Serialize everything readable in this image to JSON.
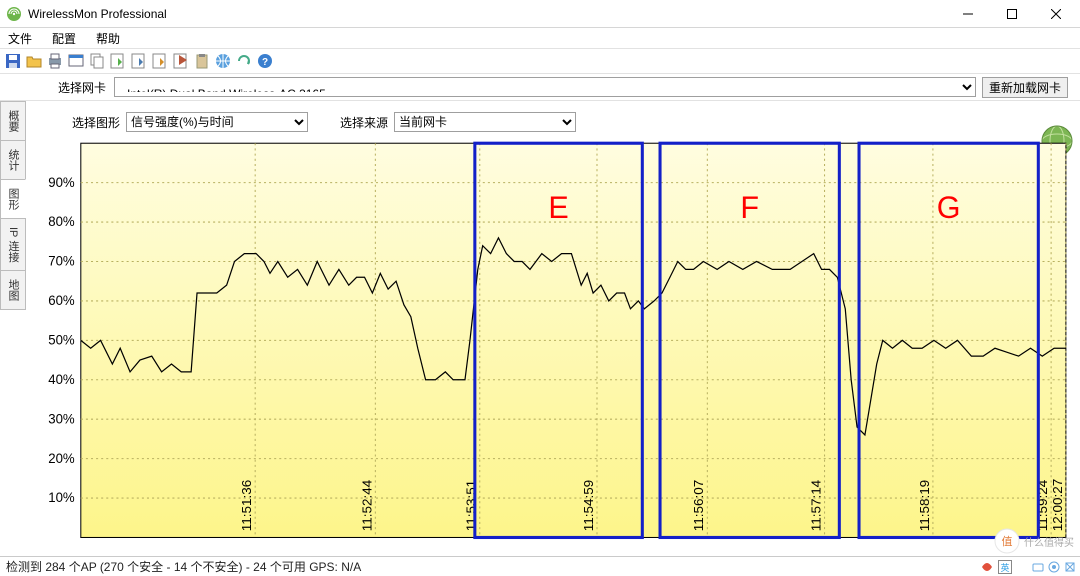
{
  "window": {
    "title": "WirelessMon Professional"
  },
  "menu": [
    "文件",
    "配置",
    "帮助"
  ],
  "adapter": {
    "label": "选择网卡",
    "value": "Intel(R) Dual Band Wireless-AC 3165",
    "reload": "重新加载网卡"
  },
  "tabs": [
    "概要",
    "统计",
    "图形",
    "IP 连接",
    "地图"
  ],
  "controls": {
    "graph_label": "选择图形",
    "graph_value": "信号强度(%)与时间",
    "source_label": "选择来源",
    "source_value": "当前网卡"
  },
  "status": {
    "text": "检测到 284 个AP (270 个安全 - 14 个不安全) - 24 个可用 GPS: N/A"
  },
  "watermark": {
    "text": "什么值得买"
  },
  "ime": {
    "lang": "英"
  },
  "annotations": [
    {
      "label": "E",
      "x0": 0.4,
      "x1": 0.57
    },
    {
      "label": "F",
      "x0": 0.588,
      "x1": 0.77
    },
    {
      "label": "G",
      "x0": 0.79,
      "x1": 0.972
    }
  ],
  "chart_data": {
    "type": "line",
    "title": "",
    "xlabel": "",
    "ylabel": "",
    "ylim": [
      0,
      100
    ],
    "y_ticks": [
      10,
      20,
      30,
      40,
      50,
      60,
      70,
      80,
      90
    ],
    "y_tick_labels": [
      "10%",
      "20%",
      "30%",
      "40%",
      "50%",
      "60%",
      "70%",
      "80%",
      "90%"
    ],
    "x_ticks": [
      0.177,
      0.299,
      0.405,
      0.524,
      0.636,
      0.755,
      0.865,
      0.985
    ],
    "x_tick_labels": [
      "11:51:36",
      "11:52:44",
      "11:53:51",
      "11:54:59",
      "11:56:07",
      "11:57:14",
      "11:58:19",
      "11:59:24"
    ],
    "extra_x_tick": {
      "x": 1.0,
      "label": "12:00:27"
    },
    "series": [
      {
        "name": "信号强度(%)",
        "points": [
          [
            0.0,
            50
          ],
          [
            0.01,
            48
          ],
          [
            0.02,
            50
          ],
          [
            0.032,
            44
          ],
          [
            0.04,
            48
          ],
          [
            0.05,
            42
          ],
          [
            0.06,
            45
          ],
          [
            0.072,
            46
          ],
          [
            0.082,
            42
          ],
          [
            0.092,
            44
          ],
          [
            0.102,
            42
          ],
          [
            0.112,
            42
          ],
          [
            0.118,
            62
          ],
          [
            0.138,
            62
          ],
          [
            0.148,
            64
          ],
          [
            0.156,
            70
          ],
          [
            0.166,
            72
          ],
          [
            0.178,
            72
          ],
          [
            0.186,
            70
          ],
          [
            0.192,
            67
          ],
          [
            0.2,
            70
          ],
          [
            0.21,
            66
          ],
          [
            0.22,
            68
          ],
          [
            0.23,
            64
          ],
          [
            0.24,
            70
          ],
          [
            0.252,
            64
          ],
          [
            0.262,
            68
          ],
          [
            0.272,
            64
          ],
          [
            0.28,
            66
          ],
          [
            0.288,
            66
          ],
          [
            0.296,
            62
          ],
          [
            0.304,
            67
          ],
          [
            0.312,
            63
          ],
          [
            0.32,
            65
          ],
          [
            0.328,
            59
          ],
          [
            0.335,
            56
          ],
          [
            0.342,
            48
          ],
          [
            0.35,
            40
          ],
          [
            0.36,
            40
          ],
          [
            0.37,
            42
          ],
          [
            0.378,
            40
          ],
          [
            0.39,
            40
          ],
          [
            0.395,
            50
          ],
          [
            0.403,
            68
          ],
          [
            0.408,
            74
          ],
          [
            0.416,
            72
          ],
          [
            0.424,
            76
          ],
          [
            0.432,
            72
          ],
          [
            0.44,
            70
          ],
          [
            0.448,
            70
          ],
          [
            0.456,
            68
          ],
          [
            0.468,
            72
          ],
          [
            0.478,
            70
          ],
          [
            0.488,
            72
          ],
          [
            0.498,
            72
          ],
          [
            0.508,
            64
          ],
          [
            0.514,
            67
          ],
          [
            0.52,
            62
          ],
          [
            0.528,
            64
          ],
          [
            0.536,
            60
          ],
          [
            0.544,
            62
          ],
          [
            0.552,
            62
          ],
          [
            0.558,
            58
          ],
          [
            0.566,
            60
          ],
          [
            0.572,
            58
          ],
          [
            0.582,
            60
          ],
          [
            0.59,
            62
          ],
          [
            0.598,
            66
          ],
          [
            0.606,
            70
          ],
          [
            0.614,
            68
          ],
          [
            0.622,
            68
          ],
          [
            0.632,
            70
          ],
          [
            0.646,
            68
          ],
          [
            0.658,
            70
          ],
          [
            0.672,
            68
          ],
          [
            0.686,
            70
          ],
          [
            0.702,
            68
          ],
          [
            0.72,
            68
          ],
          [
            0.732,
            70
          ],
          [
            0.744,
            72
          ],
          [
            0.752,
            68
          ],
          [
            0.76,
            68
          ],
          [
            0.768,
            66
          ],
          [
            0.776,
            58
          ],
          [
            0.782,
            40
          ],
          [
            0.788,
            28
          ],
          [
            0.796,
            26
          ],
          [
            0.8,
            32
          ],
          [
            0.808,
            44
          ],
          [
            0.814,
            50
          ],
          [
            0.824,
            48
          ],
          [
            0.834,
            50
          ],
          [
            0.844,
            48
          ],
          [
            0.854,
            48
          ],
          [
            0.866,
            50
          ],
          [
            0.878,
            48
          ],
          [
            0.89,
            50
          ],
          [
            0.904,
            46
          ],
          [
            0.916,
            46
          ],
          [
            0.928,
            48
          ],
          [
            0.94,
            47
          ],
          [
            0.952,
            46
          ],
          [
            0.964,
            48
          ],
          [
            0.976,
            46
          ],
          [
            0.988,
            48
          ],
          [
            1.0,
            48
          ]
        ]
      }
    ]
  }
}
